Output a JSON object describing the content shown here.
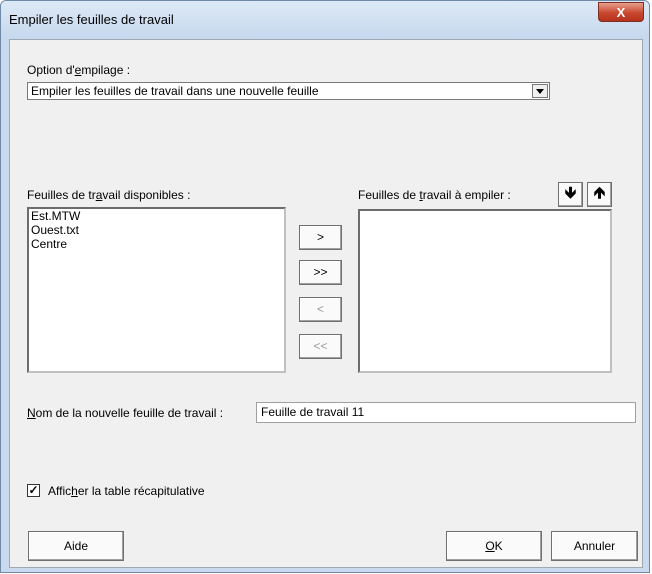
{
  "window": {
    "title": "Empiler les feuilles de travail",
    "close_label": "X"
  },
  "option": {
    "label_pre": "Option d'",
    "label_u": "e",
    "label_post": "mpilage :",
    "value": "Empiler les feuilles de travail dans une nouvelle feuille"
  },
  "available": {
    "label_pre": "Feuilles de tr",
    "label_u": "a",
    "label_post": "vail disponibles :",
    "items": [
      "Est.MTW",
      "Ouest.txt",
      "Centre"
    ]
  },
  "stack": {
    "label_pre": "Feuilles de ",
    "label_u": "t",
    "label_post": "ravail à empiler :",
    "items": []
  },
  "transfer": {
    "add_one": ">",
    "add_all": ">>",
    "remove_one": "<",
    "remove_all": "<<"
  },
  "order": {
    "down": "🡻",
    "up": "🡹"
  },
  "new_sheet": {
    "label_u": "N",
    "label_post": "om de la nouvelle feuille de travail :",
    "value": "Feuille de travail 11"
  },
  "summary": {
    "checked": true,
    "check_mark": "✓",
    "label_pre": "Affic",
    "label_u": "h",
    "label_post": "er la table récapitulative"
  },
  "buttons": {
    "help": "Aide",
    "ok_u": "O",
    "ok_post": "K",
    "cancel": "Annuler"
  }
}
